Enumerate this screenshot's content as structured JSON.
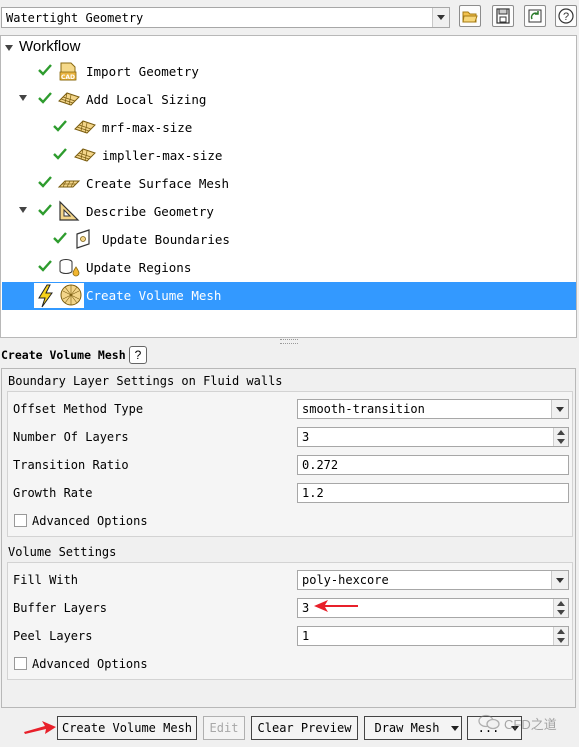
{
  "workflow_select": {
    "value": "Watertight Geometry"
  },
  "toolbar": {
    "icons": [
      "open-folder-icon",
      "save-icon",
      "refresh-icon",
      "help-icon"
    ]
  },
  "tree": {
    "header": "Workflow",
    "items": [
      {
        "label": "Import Geometry",
        "status": "done",
        "icon": "cad-import-icon"
      },
      {
        "label": "Add Local Sizing",
        "status": "done",
        "icon": "mesh-grid-icon",
        "expanded": true
      },
      {
        "label": "mrf-max-size",
        "status": "done",
        "icon": "mesh-grid-icon"
      },
      {
        "label": "impller-max-size",
        "status": "done",
        "icon": "mesh-grid-icon"
      },
      {
        "label": "Create Surface Mesh",
        "status": "done",
        "icon": "surface-mesh-icon"
      },
      {
        "label": "Describe Geometry",
        "status": "done",
        "icon": "triangle-ruler-icon",
        "expanded": true
      },
      {
        "label": "Update Boundaries",
        "status": "done",
        "icon": "boundary-icon"
      },
      {
        "label": "Update Regions",
        "status": "done",
        "icon": "regions-icon"
      },
      {
        "label": "Create Volume Mesh",
        "status": "pending",
        "icon": "volume-mesh-icon",
        "selected": true
      }
    ]
  },
  "panel": {
    "title": "Create Volume Mesh",
    "help_label": "?",
    "boundary_layer": {
      "title": "Boundary Layer Settings on Fluid walls",
      "offset_method_label": "Offset Method Type",
      "offset_method_value": "smooth-transition",
      "num_layers_label": "Number Of Layers",
      "num_layers_value": "3",
      "transition_ratio_label": "Transition Ratio",
      "transition_ratio_value": "0.272",
      "growth_rate_label": "Growth Rate",
      "growth_rate_value": "1.2",
      "advanced_label": "Advanced Options"
    },
    "volume": {
      "title": "Volume Settings",
      "fill_with_label": "Fill With",
      "fill_with_value": "poly-hexcore",
      "buffer_layers_label": "Buffer Layers",
      "buffer_layers_value": "3",
      "peel_layers_label": "Peel Layers",
      "peel_layers_value": "1",
      "advanced_label": "Advanced Options"
    }
  },
  "buttons": {
    "create": "Create Volume Mesh",
    "edit": "Edit",
    "clear_preview": "Clear Preview",
    "draw_mesh": "Draw Mesh",
    "more": "..."
  },
  "watermark": "CFD之道",
  "colors": {
    "selection": "#3399ff",
    "check": "#2e9c2e",
    "annotation_arrow": "#e8202a"
  }
}
